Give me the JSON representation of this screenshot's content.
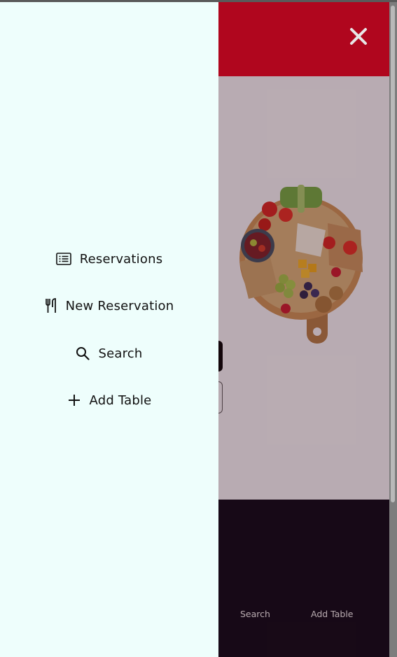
{
  "drawer": {
    "items": [
      {
        "label": "Reservations",
        "icon": "list-icon"
      },
      {
        "label": "New Reservation",
        "icon": "utensils-icon"
      },
      {
        "label": "Search",
        "icon": "search-icon"
      },
      {
        "label": "Add Table",
        "icon": "plus-icon"
      }
    ]
  },
  "footer": {
    "links": [
      {
        "label": "Search"
      },
      {
        "label": "Add Table"
      }
    ]
  },
  "colors": {
    "header": "#e8001d",
    "footer": "#070512",
    "drawer": "#eefefc"
  },
  "icons": {
    "close": "close-icon",
    "hero": "food-platter-image"
  }
}
